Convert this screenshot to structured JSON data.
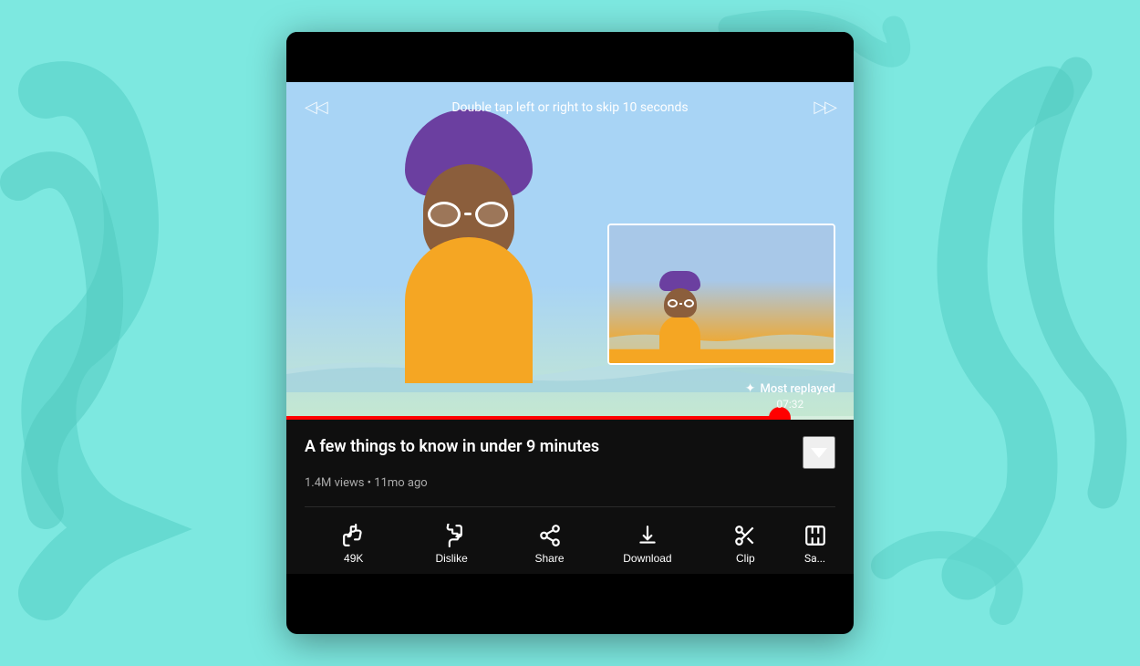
{
  "background": {
    "color": "#7de8e0"
  },
  "video": {
    "skip_hint": "Double tap left or right to skip 10 seconds",
    "title": "A few things to know in under 9 minutes",
    "views": "1.4M views",
    "time_ago": "11mo ago",
    "meta": "1.4M views • 11mo ago",
    "most_replayed_label": "Most replayed",
    "most_replayed_time": "07:32",
    "progress_percent": 87
  },
  "actions": [
    {
      "id": "like",
      "icon": "thumbs-up",
      "label": "49K"
    },
    {
      "id": "dislike",
      "icon": "thumbs-down",
      "label": "Dislike"
    },
    {
      "id": "share",
      "icon": "share",
      "label": "Share"
    },
    {
      "id": "download",
      "icon": "download",
      "label": "Download"
    },
    {
      "id": "clip",
      "icon": "clip",
      "label": "Clip"
    },
    {
      "id": "save",
      "icon": "save",
      "label": "Sa..."
    }
  ]
}
